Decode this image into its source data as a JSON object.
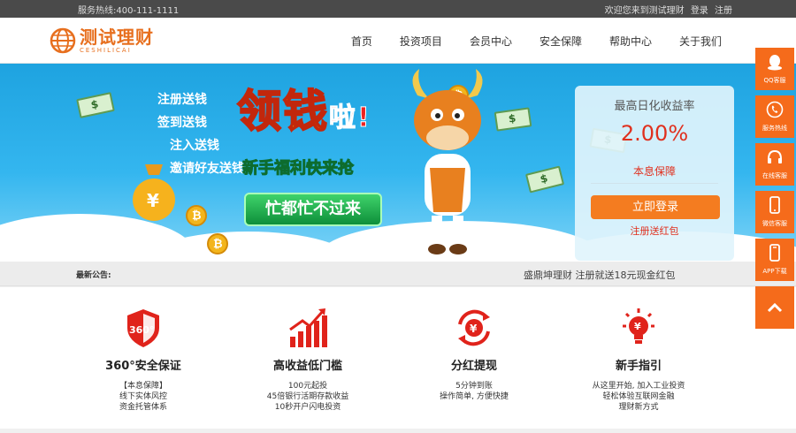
{
  "topbar": {
    "hotline": "服务热线:400-111-1111",
    "welcome": "欢迎您来到测试理财",
    "login": "登录",
    "register": "注册"
  },
  "logo": {
    "cn": "测试理财",
    "en": "CESHILICAI"
  },
  "nav": [
    "首页",
    "投资项目",
    "会员中心",
    "安全保障",
    "帮助中心",
    "关于我们"
  ],
  "hero": {
    "slogans": [
      "注册送钱",
      "签到送钱",
      "注入送钱",
      "邀请好友送钱"
    ],
    "big_title": "领钱",
    "big_title_suffix": "啦!",
    "sub_title": "新手福利快来抢",
    "badge": "忙都忙不过来"
  },
  "card": {
    "label": "最高日化收益率",
    "rate": "2.00%",
    "guarantee": "本息保障",
    "login_button": "立即登录",
    "register_link": "注册送红包"
  },
  "notice": {
    "title": "最新公告:",
    "message": "盛鼎坤理财 注册就送18元现金红包"
  },
  "features": [
    {
      "icon": "shield-360-icon",
      "name": "360°安全保证",
      "desc": [
        "【本息保障】",
        "线下实体风控",
        "资金托管体系"
      ]
    },
    {
      "icon": "bar-chart-icon",
      "name": "高收益低门槛",
      "desc": [
        "100元起投",
        "45倍银行活期存款收益",
        "10秒开户闪电投资"
      ]
    },
    {
      "icon": "yen-cycle-icon",
      "name": "分红提现",
      "desc": [
        "5分钟到账",
        "操作简单, 方便快捷"
      ]
    },
    {
      "icon": "lightbulb-icon",
      "name": "新手指引",
      "desc": [
        "从这里开始, 加入工业投资",
        "轻松体验互联网金融",
        "理财新方式"
      ]
    }
  ],
  "side": [
    {
      "icon": "qq-icon",
      "label": "QQ客服"
    },
    {
      "icon": "phone-icon",
      "label": "服务热线"
    },
    {
      "icon": "headset-icon",
      "label": "在线客服"
    },
    {
      "icon": "mobile-icon",
      "label": "微信客服"
    },
    {
      "icon": "app-icon",
      "label": "APP下载"
    },
    {
      "icon": "chevron-up-icon",
      "label": ""
    }
  ],
  "colors": {
    "accent": "#f56b1b",
    "hero": "#1ea3e0",
    "red": "#e0301e"
  }
}
